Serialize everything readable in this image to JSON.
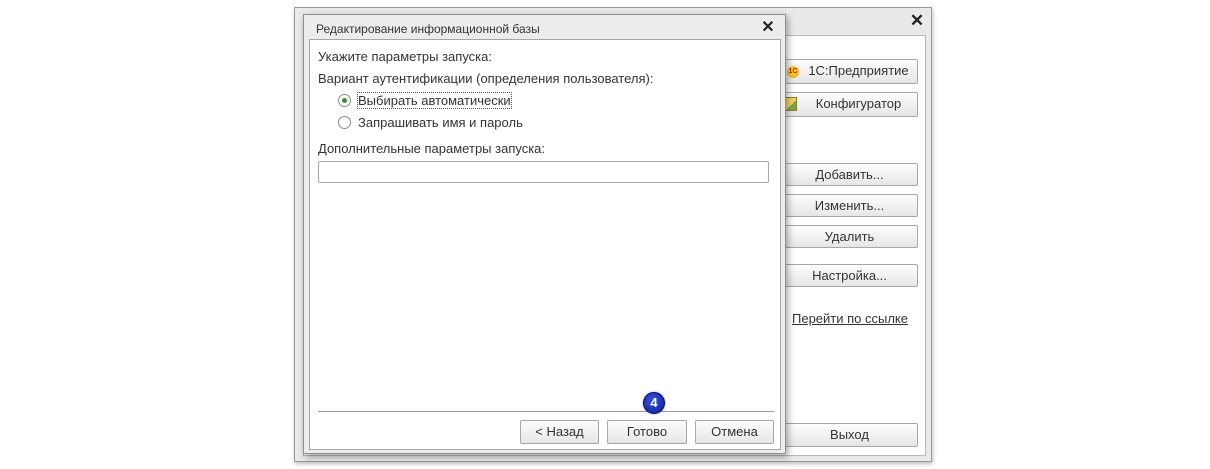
{
  "background_window": {
    "close_symbol": "✕",
    "buttons": {
      "enterprise": "1С:Предприятие",
      "configurator": "Конфигуратор",
      "add": "Добавить...",
      "edit": "Изменить...",
      "delete": "Удалить",
      "settings": "Настройка...",
      "exit": "Выход"
    },
    "link": "Перейти по ссылке",
    "icons": [
      "1c-enterprise-icon",
      "configurator-icon",
      "close-icon"
    ]
  },
  "dialog": {
    "title": "Редактирование информационной базы",
    "close_symbol": "✕",
    "heading": "Укажите параметры запуска:",
    "auth_label": "Вариант аутентификации (определения пользователя):",
    "auth_options": [
      {
        "label": "Выбирать автоматически",
        "selected": true
      },
      {
        "label": "Запрашивать имя и пароль",
        "selected": false
      }
    ],
    "extra_params_label": "Дополнительные параметры запуска:",
    "extra_params_value": "",
    "buttons": {
      "back": "< Назад",
      "finish": "Готово",
      "cancel": "Отмена"
    }
  },
  "annotation": {
    "step_number": "4"
  },
  "colors": {
    "radio_selected": "#3a8d3a",
    "badge": "#0a1f9c"
  }
}
